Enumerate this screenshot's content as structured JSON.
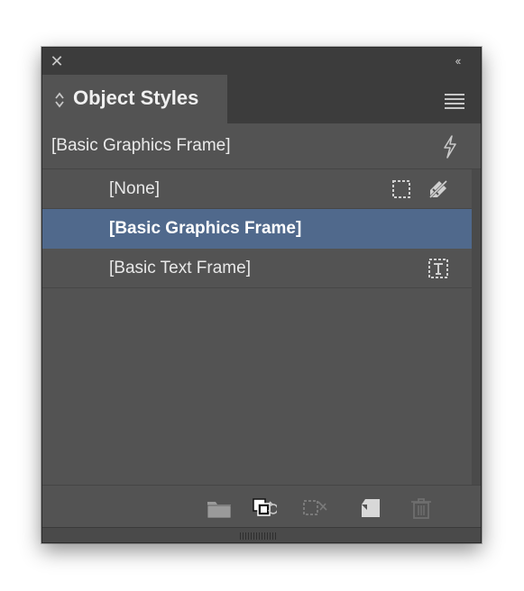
{
  "panel": {
    "title": "Object Styles",
    "default_style": "[Basic Graphics Frame]",
    "close_glyph": "✕",
    "collapse_glyph": "‹‹"
  },
  "styles": [
    {
      "label": "[None]",
      "selected": false,
      "icons": [
        "frame-icon",
        "eraser-icon"
      ]
    },
    {
      "label": "[Basic Graphics Frame]",
      "selected": true,
      "icons": []
    },
    {
      "label": "[Basic Text Frame]",
      "selected": false,
      "icons": [
        "text-frame-icon"
      ]
    }
  ],
  "toolbar": {
    "buttons": [
      "new-group-button",
      "clear-overrides-button",
      "clear-non-style-attributes-button",
      "new-style-button",
      "delete-button"
    ]
  },
  "colors": {
    "panel_bg": "#535353",
    "header_bg": "#3c3c3c",
    "selection": "#50698c",
    "text": "#e8e8e8"
  }
}
